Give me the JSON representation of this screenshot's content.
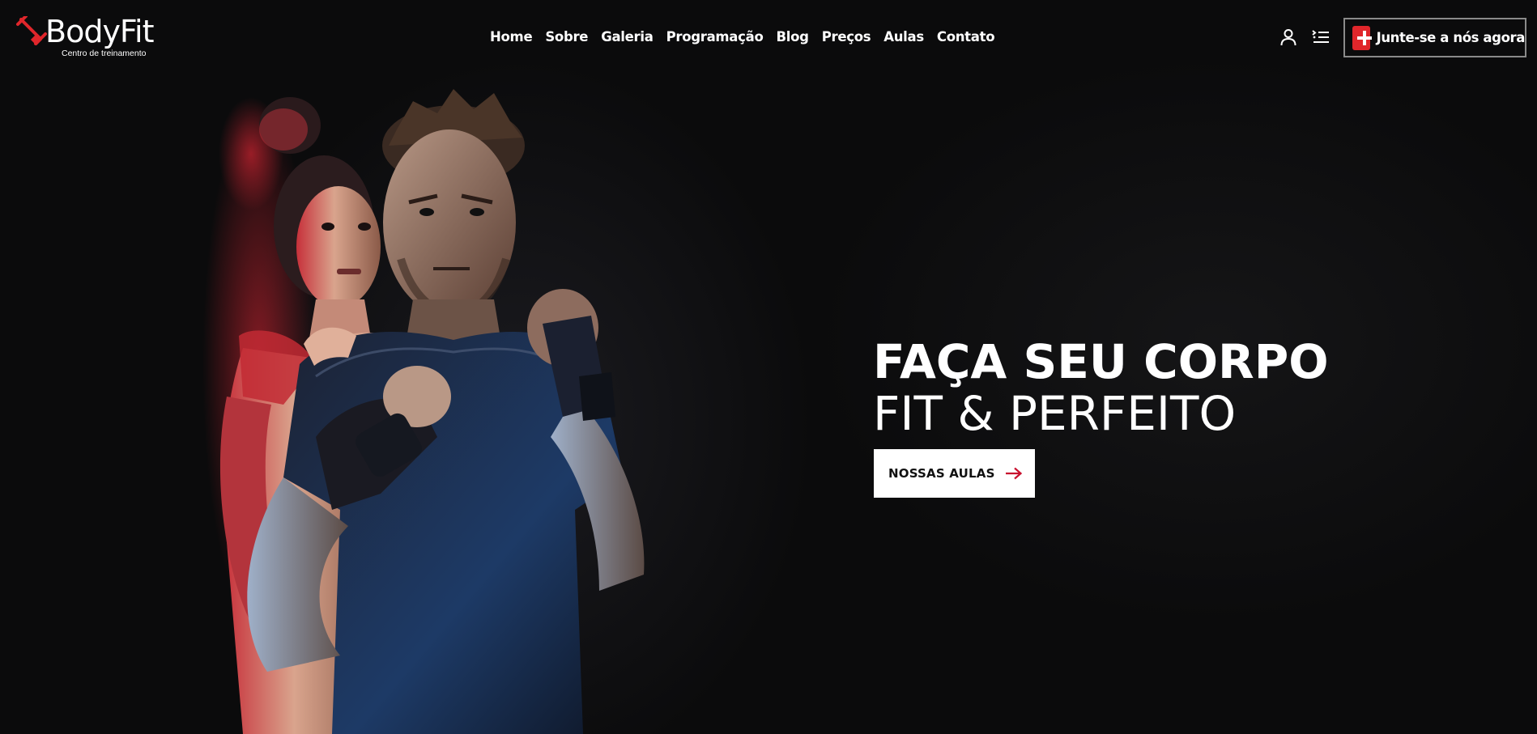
{
  "brand": {
    "name": "BodyFit",
    "tagline": "Centro de treinamento",
    "icon": "dumbbell-icon",
    "accent_color": "#e0262b"
  },
  "nav": {
    "items": [
      {
        "label": "Home"
      },
      {
        "label": "Sobre"
      },
      {
        "label": "Galeria"
      },
      {
        "label": "Programação"
      },
      {
        "label": "Blog"
      },
      {
        "label": "Preços"
      },
      {
        "label": "Aulas"
      },
      {
        "label": "Contato"
      }
    ]
  },
  "header_actions": {
    "account_icon": "user-icon",
    "menu_icon": "list-menu-icon",
    "join_label": "Junte-se a nós agora",
    "join_icon": "plus-icon"
  },
  "hero": {
    "title_line1": "FAÇA SEU CORPO",
    "title_line2": "FIT & PERFEITO",
    "cta_label": "NOSSAS AULAS",
    "cta_icon": "arrow-right-icon",
    "image": "fitness-couple-photo"
  }
}
